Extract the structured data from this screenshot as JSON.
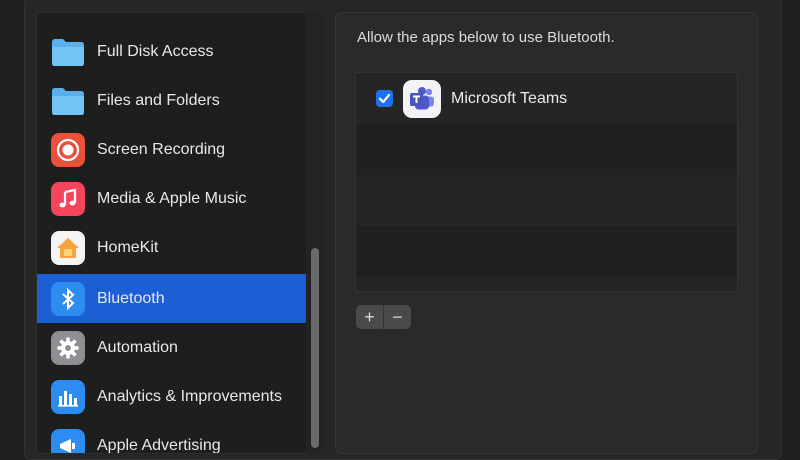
{
  "sidebar": {
    "items": [
      {
        "label": "Full Disk Access",
        "icon": "folder-icon"
      },
      {
        "label": "Files and Folders",
        "icon": "folder-icon"
      },
      {
        "label": "Screen Recording",
        "icon": "screen-recording-icon"
      },
      {
        "label": "Media & Apple Music",
        "icon": "music-note-icon"
      },
      {
        "label": "HomeKit",
        "icon": "home-icon"
      },
      {
        "label": "Bluetooth",
        "icon": "bluetooth-icon",
        "selected": true
      },
      {
        "label": "Automation",
        "icon": "gear-icon"
      },
      {
        "label": "Analytics & Improvements",
        "icon": "bar-chart-icon"
      },
      {
        "label": "Apple Advertising",
        "icon": "megaphone-icon"
      }
    ]
  },
  "main": {
    "instruction": "Allow the apps below to use Bluetooth.",
    "apps": [
      {
        "name": "Microsoft Teams",
        "checked": true,
        "icon": "microsoft-teams-icon"
      }
    ],
    "add_label": "+",
    "remove_label": "−"
  },
  "colors": {
    "selection": "#1c5fd4",
    "checkbox": "#1f6ff2",
    "background": "#1f1f1f"
  }
}
